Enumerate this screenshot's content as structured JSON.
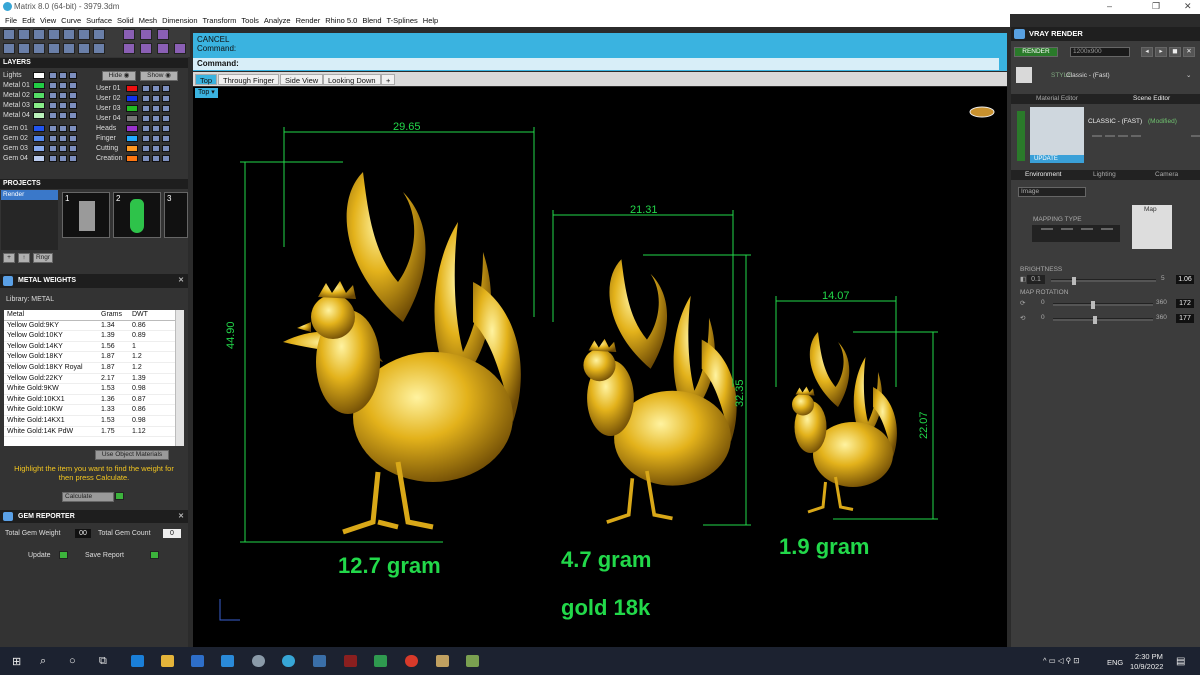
{
  "window": {
    "title": "Matrix 8.0 (64-bit) - 3979.3dm"
  },
  "menu": [
    "File",
    "Edit",
    "View",
    "Curve",
    "Surface",
    "Solid",
    "Mesh",
    "Dimension",
    "Transform",
    "Tools",
    "Analyze",
    "Render",
    "Rhino 5.0",
    "Blend",
    "T-Splines",
    "Help"
  ],
  "layers": {
    "title": "LAYERS",
    "hide_label": "Hide",
    "show_label": "Show",
    "left": [
      {
        "name": "Lights",
        "color": "#ffffff"
      },
      {
        "name": "Metal 01",
        "color": "#22cc44"
      },
      {
        "name": "Metal 02",
        "color": "#55dd66"
      },
      {
        "name": "Metal 03",
        "color": "#88ee88"
      },
      {
        "name": "Metal 04",
        "color": "#bbf2bb"
      },
      {
        "name": "Gem 01",
        "color": "#2255ee"
      },
      {
        "name": "Gem 02",
        "color": "#5588ee"
      },
      {
        "name": "Gem 03",
        "color": "#88aaee"
      },
      {
        "name": "Gem 04",
        "color": "#bbccee"
      }
    ],
    "right": [
      {
        "name": "User 01",
        "color": "#ee1111"
      },
      {
        "name": "User 02",
        "color": "#1133ee"
      },
      {
        "name": "User 03",
        "color": "#22bb22"
      },
      {
        "name": "User 04",
        "color": "#777777"
      },
      {
        "name": "Heads",
        "color": "#9933cc"
      },
      {
        "name": "Finger",
        "color": "#22aaff"
      },
      {
        "name": "Cutting",
        "color": "#ff9922"
      },
      {
        "name": "Creation",
        "color": "#ff7711"
      }
    ]
  },
  "projects": {
    "title": "PROJECTS",
    "item": "Render",
    "slots": [
      "1",
      "2",
      "3"
    ],
    "ring_label": "Rngr"
  },
  "metal_weights": {
    "title": "METAL WEIGHTS",
    "library_label": "Library: METAL",
    "col_metal": "Metal",
    "col_grams": "Grams",
    "col_dwt": "DWT",
    "rows": [
      [
        "Yellow Gold:9KY",
        "1.34",
        "0.86"
      ],
      [
        "Yellow Gold:10KY",
        "1.39",
        "0.89"
      ],
      [
        "Yellow Gold:14KY",
        "1.56",
        "1"
      ],
      [
        "Yellow Gold:18KY",
        "1.87",
        "1.2"
      ],
      [
        "Yellow Gold:18KY Royal",
        "1.87",
        "1.2"
      ],
      [
        "Yellow Gold:22KY",
        "2.17",
        "1.39"
      ],
      [
        "White Gold:9KW",
        "1.53",
        "0.98"
      ],
      [
        "White Gold:10KX1",
        "1.36",
        "0.87"
      ],
      [
        "White Gold:10KW",
        "1.33",
        "0.86"
      ],
      [
        "White Gold:14KX1",
        "1.53",
        "0.98"
      ],
      [
        "White Gold:14K PdW",
        "1.75",
        "1.12"
      ]
    ],
    "use_object_materials": "Use Object Materials",
    "hint": "Highlight the item you want to find the weight for then press Calculate.",
    "calculate": "Calculate"
  },
  "gem_reporter": {
    "title": "GEM REPORTER",
    "total_gem_weight_label": "Total Gem Weight",
    "total_gem_weight": "00",
    "total_gem_count_label": "Total Gem Count",
    "total_gem_count": "0",
    "update": "Update",
    "save_report": "Save Report"
  },
  "command": {
    "line1": "CANCEL",
    "line2": "Command:",
    "line3": "Command:"
  },
  "view_tabs": [
    "Top",
    "Through Finger",
    "Side View",
    "Looking Down"
  ],
  "viewport_label": "Top",
  "dims": {
    "d1": "29.65",
    "d2": "44.90",
    "d3": "21.31",
    "d4": "32.35",
    "d5": "14.07",
    "d6": "22.07"
  },
  "captions": {
    "c1": "12.7 gram",
    "c2": "4.7 gram",
    "c3": "1.9 gram",
    "c4": "gold 18k"
  },
  "vray": {
    "title": "VRAY RENDER",
    "render": "RENDER",
    "resolution": "1200x900",
    "style_label": "STYLE",
    "style_value": "Classic - (Fast)",
    "tab_material": "Material Editor",
    "tab_scene": "Scene Editor",
    "scene_name": "CLASSIC - (FAST)",
    "scene_status": "(Modified)",
    "update": "UPDATE",
    "tab_env": "Environment",
    "tab_light": "Lighting",
    "tab_cam": "Camera",
    "env_type": "Image",
    "mapping_type": "MAPPING TYPE",
    "map_label": "Map",
    "brightness_label": "BRIGHTNESS",
    "brightness_min": "0.1",
    "brightness_max": "5",
    "brightness_value": "1.06",
    "brightness_level": 0.2,
    "rotation_label": "MAP ROTATION",
    "rot_min": "0",
    "rot_max": "360",
    "rot1": "172",
    "rot2": "177"
  },
  "tray": {
    "lang": "ENG",
    "time": "2:30 PM",
    "date": "10/9/2022"
  }
}
